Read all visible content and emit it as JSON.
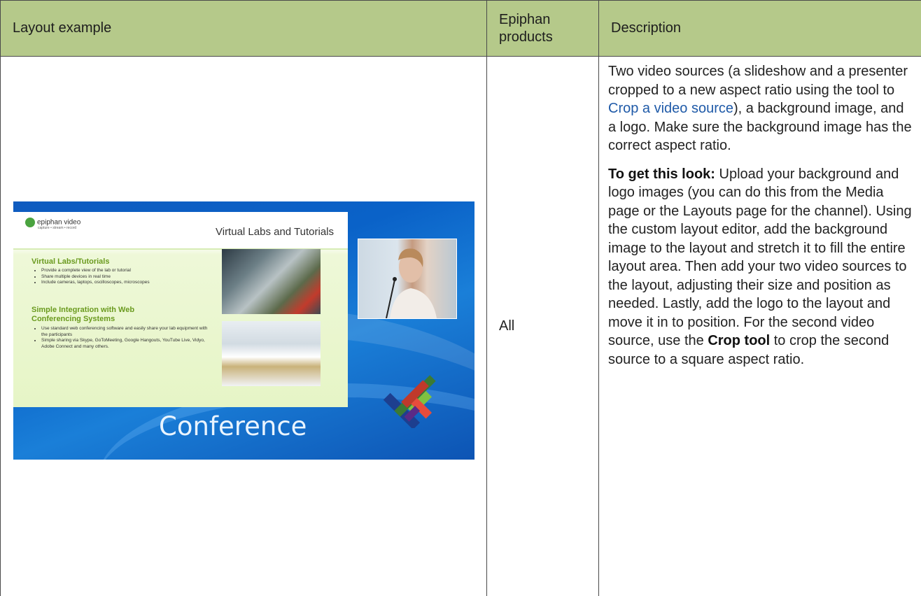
{
  "table": {
    "headers": [
      "Layout example",
      "Epiphan products",
      "Description"
    ],
    "row": {
      "products": "All",
      "description": {
        "p1_text_a": "Two video sources (a slideshow and a presenter cropped to a new aspect ratio using the tool to ",
        "p1_link": "Crop a video source",
        "p1_text_b": "), a background image, and a logo. Make sure the background image has the correct aspect ratio.",
        "p2_strong": "To get this look:",
        "p2_text_a": " Upload your background and logo images (you can do this from the Media page or the Layouts page for the channel). Using the custom layout editor, add the background image to the layout and stretch it to fill the entire layout area. Then add your two video sources to the layout, adjusting their size and position as needed. Lastly, add the logo to the layout and move it in to position. For the second video source, use the ",
        "p2_strong2": "Crop tool",
        "p2_text_b": " to crop the second source to a square aspect ratio."
      }
    }
  },
  "example_image": {
    "slide_brand": "epiphan video",
    "slide_tagline": "capture • stream • record",
    "slide_title": "Virtual Labs and Tutorials",
    "section1_heading": "Virtual Labs/Tutorials",
    "section1_bullets": [
      "Provide a complete view of the lab or tutorial",
      "Share multiple devices in real time",
      "Include cameras, laptops, oscilloscopes, microscopes"
    ],
    "section2_heading_line1": "Simple Integration with Web",
    "section2_heading_line2": "Conferencing Systems",
    "section2_bullets": [
      "Use standard web conferencing software and easily share your lab equipment with the participants",
      "Simple sharing via Skype, GoToMeeting, Google Hangouts, YouTube Live, Vidyo, Adobe Connect and many others."
    ],
    "background_text": "Conference"
  },
  "colors": {
    "header_bg": "#b5c98a",
    "link": "#1f5aa8",
    "border": "#4a4a4a"
  }
}
